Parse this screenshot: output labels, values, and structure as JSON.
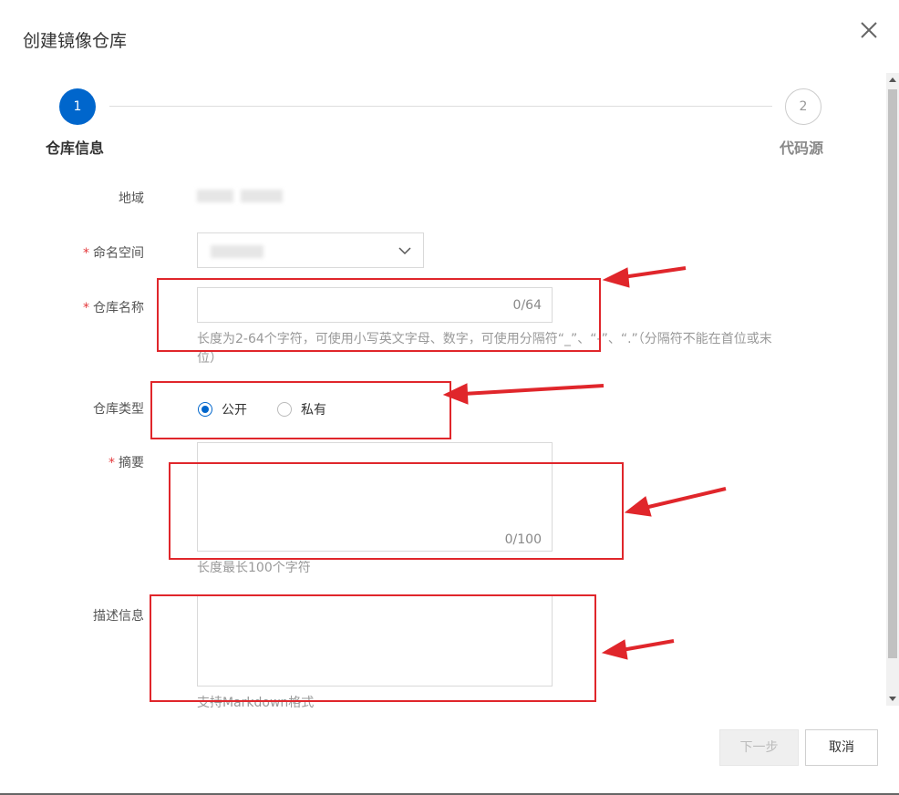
{
  "dialog": {
    "title": "创建镜像仓库"
  },
  "steps": [
    {
      "number": "1",
      "label": "仓库信息",
      "state": "active"
    },
    {
      "number": "2",
      "label": "代码源",
      "state": "pending"
    }
  ],
  "form": {
    "region": {
      "label": "地域"
    },
    "namespace": {
      "label": "命名空间",
      "required_mark": "*"
    },
    "repo_name": {
      "label": "仓库名称",
      "required_mark": "*",
      "value": "",
      "counter": "0/64",
      "hint": "长度为2-64个字符，可使用小写英文字母、数字，可使用分隔符“_”、“-”、“.”（分隔符不能在首位或末位）"
    },
    "repo_type": {
      "label": "仓库类型",
      "options": [
        {
          "label": "公开",
          "checked": true
        },
        {
          "label": "私有",
          "checked": false
        }
      ]
    },
    "summary": {
      "label": "摘要",
      "required_mark": "*",
      "value": "",
      "counter": "0/100",
      "hint": "长度最长100个字符"
    },
    "description": {
      "label": "描述信息",
      "value": "",
      "hint": "支持Markdown格式"
    }
  },
  "footer": {
    "next_label": "下一步",
    "cancel_label": "取消"
  },
  "colors": {
    "primary": "#0066cc",
    "annotation": "#e0262b",
    "required": "#e4393c"
  },
  "icons": {
    "close": "close-icon",
    "dropdown": "chevron-down-icon"
  }
}
